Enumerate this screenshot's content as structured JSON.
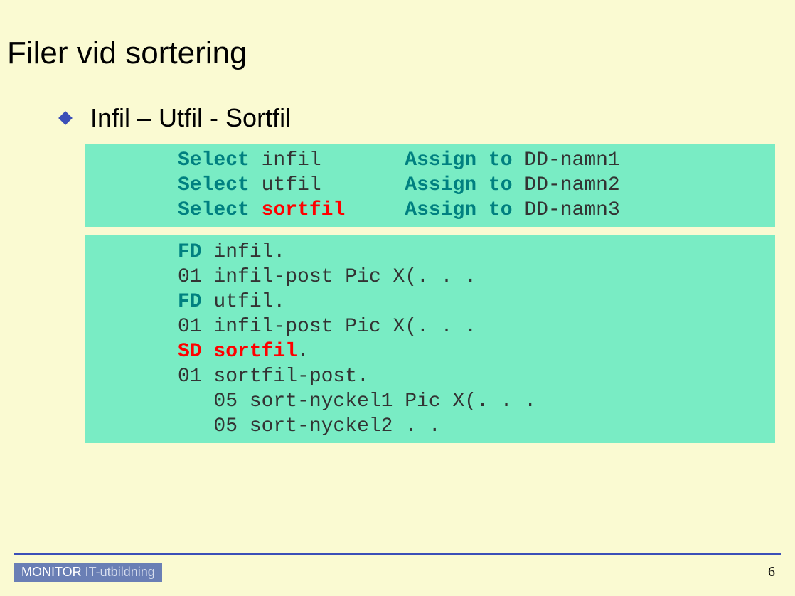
{
  "title": "Filer vid sortering",
  "bullet": "Infil – Utfil - Sortfil",
  "code1": {
    "l1_select": "Select",
    "l1_file": " infil       ",
    "l1_assign": "Assign to",
    "l1_dd": " DD-namn1",
    "l2_select": "Select",
    "l2_file": " utfil       ",
    "l2_assign": "Assign to",
    "l2_dd": " DD-namn2",
    "l3_select": "Select",
    "l3_sp": " ",
    "l3_file": "sortfil",
    "l3_sp2": "     ",
    "l3_assign": "Assign to",
    "l3_dd": " DD-namn3"
  },
  "code2": {
    "l1_fd": "FD",
    "l1_rest": " infil.",
    "l2": "01 infil-post Pic X(. . .",
    "l3_fd": "FD",
    "l3_rest": " utfil.",
    "l4": "01 infil-post Pic X(. . .",
    "l5_sd": "SD sortfil",
    "l5_dot": ".",
    "l6": "01 sortfil-post.",
    "l7": "   05 sort-nyckel1 Pic X(. . .",
    "l8": "   05 sort-nyckel2 . ."
  },
  "footer": {
    "brand": "MONITOR ",
    "sub": "IT-utbildning"
  },
  "page": "6"
}
